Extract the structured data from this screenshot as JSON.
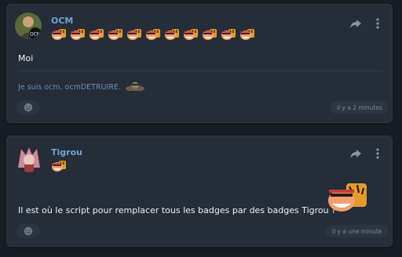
{
  "posts": [
    {
      "author": "OCM",
      "avatar_label": "OCM",
      "badge_count": 11,
      "body": "Moi",
      "signature": "Je suis ocm. ocmDETRUIRE.",
      "time": "il y a 2 minutes"
    },
    {
      "author": "Tigrou",
      "badge_count": 1,
      "body": "Il est où le script pour remplacer tous les badges par des badges Tigrou ?",
      "time": "il y a une minute"
    }
  ],
  "colors": {
    "background": "#181d24",
    "card": "#252d38",
    "username": "#6ea4d4",
    "signature": "#6d8fb4"
  },
  "icons": [
    "share-icon",
    "more-vertical-icon",
    "reaction-smiley-icon",
    "tiger-badge-icon"
  ]
}
